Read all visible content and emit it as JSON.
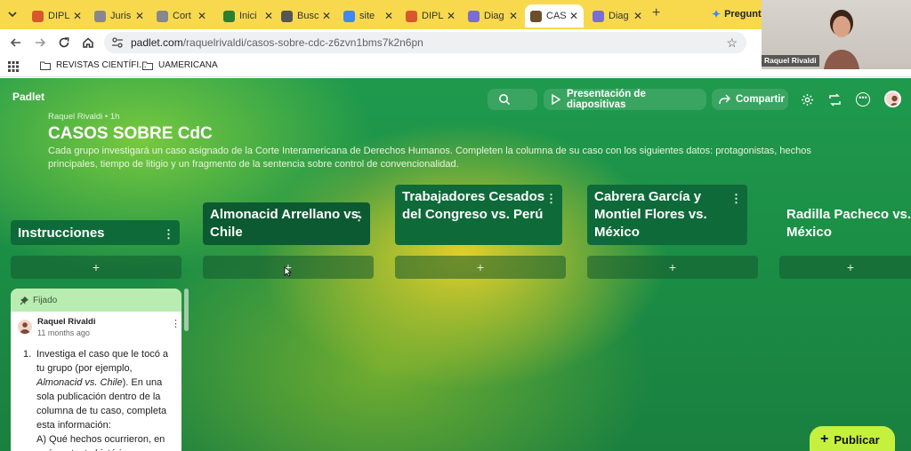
{
  "tabs": [
    {
      "label": "DIPL",
      "fav": "#d9582b"
    },
    {
      "label": "Juris",
      "fav": "#888"
    },
    {
      "label": "Cort",
      "fav": "#888"
    },
    {
      "label": "Inici",
      "fav": "#2e7d32"
    },
    {
      "label": "Busc",
      "fav": "#555"
    },
    {
      "label": "site",
      "fav": "#4285f4"
    },
    {
      "label": "DIPL",
      "fav": "#d9582b"
    },
    {
      "label": "Diag",
      "fav": "#7b6cd9"
    },
    {
      "label": "CAS",
      "fav": "#6b4f2a"
    },
    {
      "label": "Diag",
      "fav": "#7b6cd9"
    }
  ],
  "new_tab": "+",
  "gemini_label": "Pregunta",
  "address": {
    "prefix": "padlet.com",
    "rest": "/raquelrivaldi/casos-sobre-cdc-z6zvn1bms7k2n6pn"
  },
  "bookmarks": [
    {
      "label": "REVISTAS CIENTÍFI..."
    },
    {
      "label": "UAMERICANA"
    }
  ],
  "webcam_name": "Raquel Rivaldi",
  "padlet": {
    "logo": "Padlet",
    "slideshow_label": "Presentación de diapositivas",
    "share_label": "Compartir",
    "author_line": "Raquel Rivaldi • 1h",
    "title": "CASOS SOBRE CdC",
    "description": "Cada grupo investigará un caso asignado de la Corte Interamericana de Derechos Humanos. Completen la columna de su caso con los siguientes datos: protagonistas, hechos principales, tiempo de litigio y un fragmento de la sentencia sobre control de convencionalidad.",
    "columns": [
      {
        "title": "Instrucciones"
      },
      {
        "title": "Almonacid Arrellano vs. Chile"
      },
      {
        "title": "Trabajadores Cesados del Congreso vs. Perú"
      },
      {
        "title": "Cabrera García y Montiel Flores vs. México"
      },
      {
        "title": "Radilla Pacheco vs. México"
      }
    ],
    "add_symbol": "+",
    "card": {
      "pinned_label": "Fijado",
      "author": "Raquel Rivaldi",
      "time": "11 months ago",
      "item_number": "1.",
      "text_a": "Investiga el caso que le tocó a tu grupo (por ejemplo, ",
      "text_italic": "Almonacid vs. Chile",
      "text_b": "). En una sola publicación dentro de la columna de tu caso, completa esta información:",
      "text_c": "A) Qué hechos ocurrieron, en qué contexto histórico"
    },
    "publish_label": "Publicar"
  }
}
